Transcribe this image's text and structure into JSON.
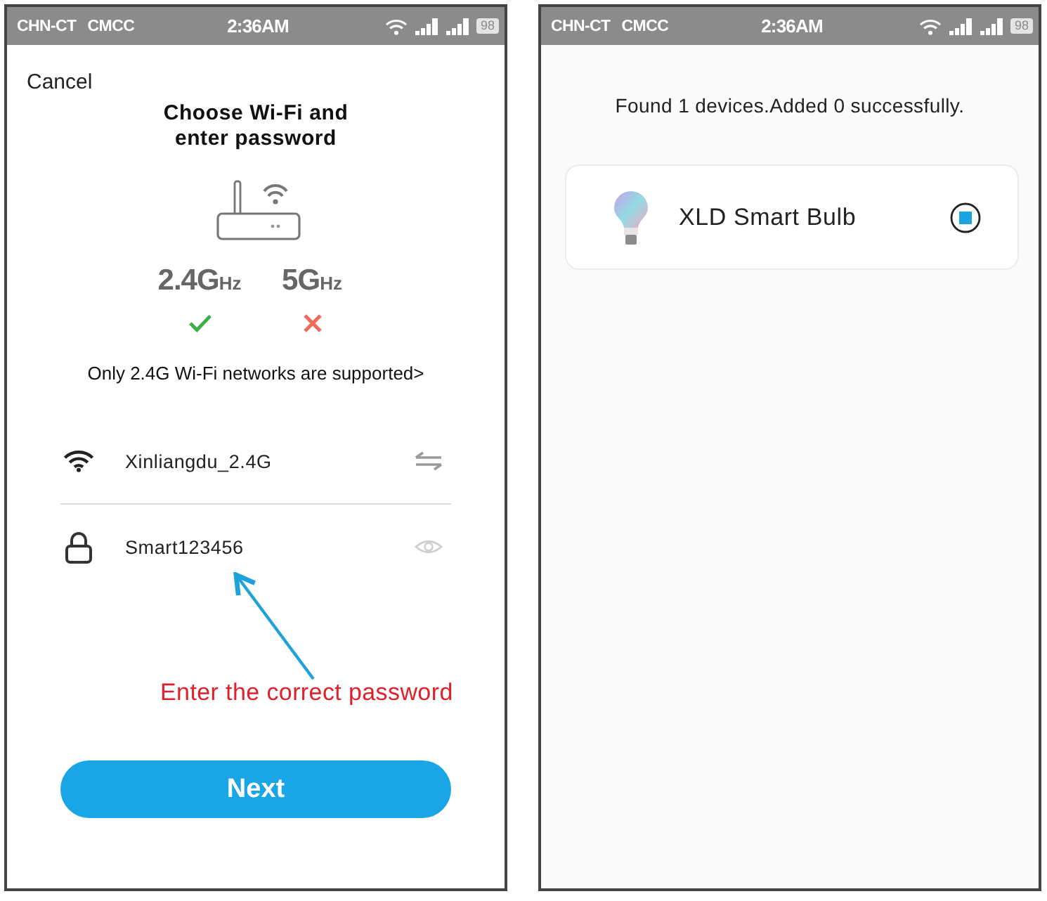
{
  "screens": [
    {
      "kind": "wifi_setup",
      "status_bar": {
        "carriers": [
          "CHN-CT",
          "CMCC"
        ],
        "time": "2:36AM",
        "battery": "98"
      },
      "cancel": "Cancel",
      "title": "Choose Wi-Fi and enter password",
      "bands": [
        {
          "label": "2.4G",
          "unit": "Hz",
          "supported": true
        },
        {
          "label": "5G",
          "unit": "Hz",
          "supported": false
        }
      ],
      "note": "Only 2.4G Wi-Fi networks are supported>",
      "network": {
        "ssid": "Xinliangdu_2.4G"
      },
      "password": {
        "value": "Smart123456"
      },
      "annotation": "Enter the correct password",
      "next_button": "Next"
    },
    {
      "kind": "device_search",
      "status_bar": {
        "carriers": [
          "CHN-CT",
          "CMCC"
        ],
        "time": "2:36AM",
        "battery": "98"
      },
      "message": "Found 1 devices.Added 0 successfully.",
      "devices": [
        {
          "name": "XLD Smart Bulb",
          "selected": true
        }
      ]
    }
  ]
}
